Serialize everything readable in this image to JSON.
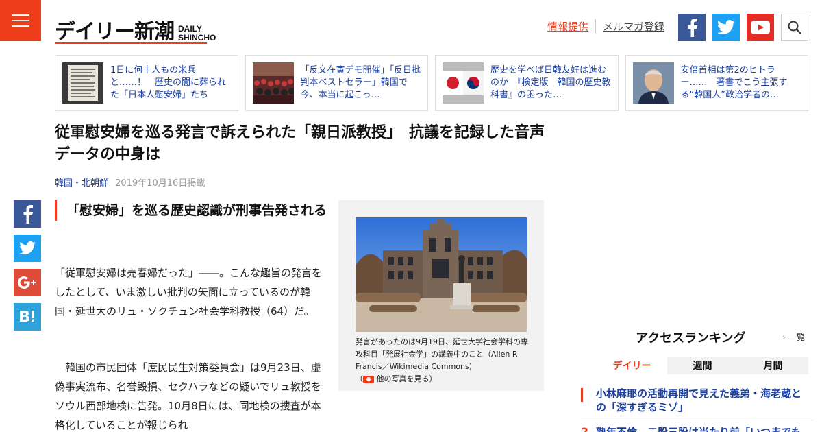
{
  "header": {
    "logo_jp": "デイリー新潮",
    "logo_en_line1": "DAILY",
    "logo_en_line2": "SHINCHO",
    "link_tip": "情報提供",
    "link_newsletter": "メルマガ登録",
    "accent_color": "#ee3d1b"
  },
  "related": [
    {
      "text": "1日に何十人もの米兵と……！　歴史の闇に葬られた「日本人慰安婦」たち"
    },
    {
      "text": "「反文在寅デモ開催」「反日批判本ベストセラー」韓国で今、本当に起こっ…"
    },
    {
      "text": "歴史を学べば日韓友好は進むのか　『検定版　韓国の歴史教科書』の困った…"
    },
    {
      "text": "安倍首相は第2のヒトラー……　著書でこう主張する“韓国人”政治学者の…"
    }
  ],
  "article": {
    "title": "従軍慰安婦を巡る発言で訴えられた「親日派教授」　抗議を記録した音声データの中身は",
    "category": "韓国・北朝鮮",
    "date": "2019年10月16日掲載",
    "subhead": "「慰安婦」を巡る歴史認識が刑事告発される",
    "para1": "「従軍慰安婦は売春婦だった」――。こんな趣旨の発言をしたとして、いま激しい批判の矢面に立っているのが韓国・延世大のリュ・ソクチュン社会学科教授（64）だ。",
    "para2": "　韓国の市民団体「庶民民生対策委員会」は9月23日、虚偽事実流布、名誉毀損、セクハラなどの疑いでリュ教授をソウル西部地検に告発。10月8日には、同地検の捜査が本格化していることが報じられ",
    "caption_main": "発言があったのは9月19日、延世大学社会学科の専攻科目「発展社会学」の講義中のこと（Allen R Francis／Wikimedia Commons）",
    "caption_open": "（",
    "caption_link": " 他の写真を見る）"
  },
  "ranking": {
    "title": "アクセスランキング",
    "all_link": "一覧",
    "tabs": [
      "デイリー",
      "週間",
      "月間"
    ],
    "items": [
      {
        "rank": "1",
        "text": "小林麻耶の活動再開で見えた義弟・海老蔵との「深すぎるミゾ」"
      },
      {
        "rank": "2",
        "text": "熟年不倫　二股三股は当たり前「いつまでもSEX"
      }
    ]
  }
}
